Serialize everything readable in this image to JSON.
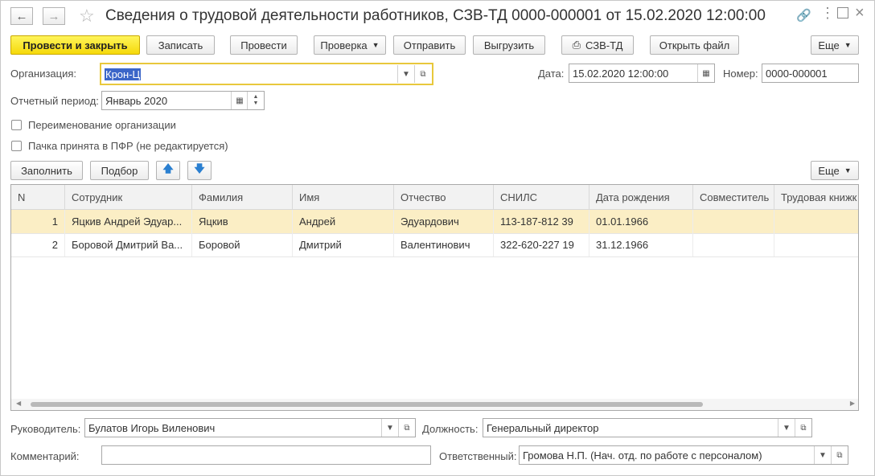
{
  "window": {
    "title": "Сведения о трудовой деятельности работников, СЗВ-ТД 0000-000001 от 15.02.2020 12:00:00"
  },
  "toolbar": {
    "post_close": "Провести и закрыть",
    "save": "Записать",
    "post": "Провести",
    "check": "Проверка",
    "send": "Отправить",
    "export": "Выгрузить",
    "print_szv": "СЗВ-ТД",
    "open_file": "Открыть файл",
    "more": "Еще"
  },
  "form": {
    "org_label": "Организация:",
    "org_value": "Крон-Ц",
    "date_label": "Дата:",
    "date_value": "15.02.2020 12:00:00",
    "number_label": "Номер:",
    "number_value": "0000-000001",
    "period_label": "Отчетный период:",
    "period_value": "Январь 2020",
    "rename_label": "Переименование организации",
    "accepted_label": "Пачка принята в ПФР (не редактируется)"
  },
  "table_toolbar": {
    "fill": "Заполнить",
    "pick": "Подбор",
    "more": "Еще"
  },
  "table": {
    "columns": [
      "N",
      "Сотрудник",
      "Фамилия",
      "Имя",
      "Отчество",
      "СНИЛС",
      "Дата рождения",
      "Совместитель",
      "Трудовая книжк"
    ],
    "rows": [
      [
        "1",
        "Яцкив Андрей Эдуар...",
        "Яцкив",
        "Андрей",
        "Эдуардович",
        "113-187-812 39",
        "01.01.1966",
        "",
        ""
      ],
      [
        "2",
        "Боровой Дмитрий Ва...",
        "Боровой",
        "Дмитрий",
        "Валентинович",
        "322-620-227 19",
        "31.12.1966",
        "",
        ""
      ]
    ],
    "selected_row": 0
  },
  "footer": {
    "head_label": "Руководитель:",
    "head_value": "Булатов Игорь Виленович",
    "position_label": "Должность:",
    "position_value": "Генеральный директор",
    "comment_label": "Комментарий:",
    "comment_value": "",
    "responsible_label": "Ответственный:",
    "responsible_value": "Громова Н.П. (Нач. отд. по работе с персоналом)"
  },
  "colors": {
    "primary_button": "#f5d90a",
    "selected_row": "#fbeec5",
    "focus_border": "#e8c83c",
    "selection_highlight": "#3b66c8"
  }
}
